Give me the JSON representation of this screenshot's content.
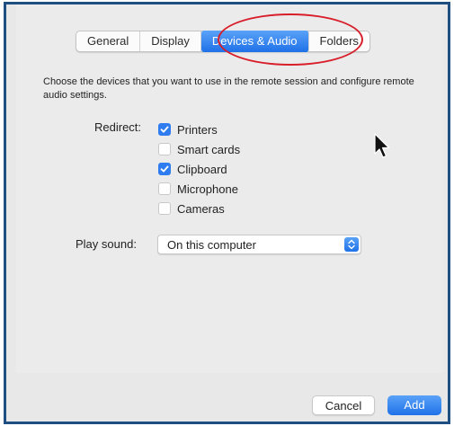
{
  "tabs": [
    {
      "label": "General",
      "active": false
    },
    {
      "label": "Display",
      "active": false
    },
    {
      "label": "Devices & Audio",
      "active": true
    },
    {
      "label": "Folders",
      "active": false
    }
  ],
  "description": "Choose the devices that you want to use in the remote session and configure remote audio settings.",
  "redirect": {
    "label": "Redirect:",
    "options": [
      {
        "label": "Printers",
        "checked": true
      },
      {
        "label": "Smart cards",
        "checked": false
      },
      {
        "label": "Clipboard",
        "checked": true
      },
      {
        "label": "Microphone",
        "checked": false
      },
      {
        "label": "Cameras",
        "checked": false
      }
    ]
  },
  "play_sound": {
    "label": "Play sound:",
    "value": "On this computer"
  },
  "buttons": {
    "cancel": "Cancel",
    "add": "Add"
  },
  "colors": {
    "accent": "#1f71e8",
    "highlight_ring": "#d81e2a",
    "frame_border": "#1f4f82"
  },
  "icons": {
    "checkmark": "checkmark-icon",
    "stepper": "up-down-chevron-icon",
    "cursor": "mouse-pointer-icon"
  }
}
